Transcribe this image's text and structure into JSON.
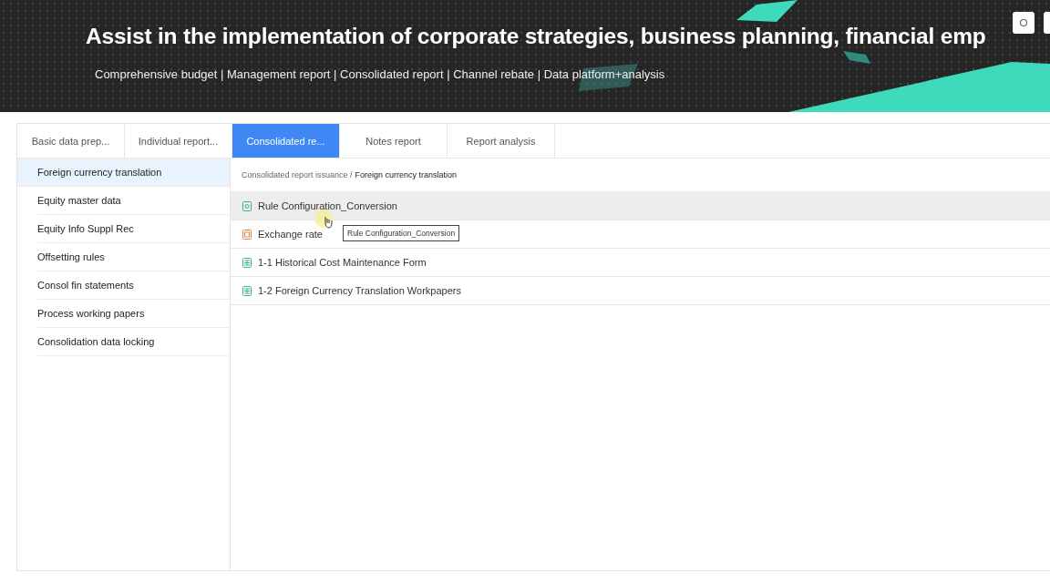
{
  "banner": {
    "title": "Assist in the implementation of corporate strategies, business planning, financial emp",
    "subtitle": "Comprehensive budget | Management report | Consolidated report | Channel rebate | Data platform+analysis"
  },
  "tabs": [
    {
      "label": "Basic data prep...",
      "selected": false
    },
    {
      "label": "Individual report...",
      "selected": false
    },
    {
      "label": "Consolidated re...",
      "selected": true
    },
    {
      "label": "Notes report",
      "selected": false
    },
    {
      "label": "Report analysis",
      "selected": false
    }
  ],
  "sidebar": {
    "items": [
      {
        "label": "Foreign currency translation",
        "selected": true
      },
      {
        "label": "Equity master data",
        "selected": false
      },
      {
        "label": "Equity Info Suppl Rec",
        "selected": false
      },
      {
        "label": "Offsetting rules",
        "selected": false
      },
      {
        "label": "Consol fin statements",
        "selected": false
      },
      {
        "label": "Process working papers",
        "selected": false
      },
      {
        "label": "Consolidation data locking",
        "selected": false
      }
    ]
  },
  "breadcrumb": {
    "parent": "Consolidated report issuance /",
    "current": "Foreign currency translation"
  },
  "files": [
    {
      "label": "Rule Configuration_Conversion",
      "kind": "document",
      "hovered": true
    },
    {
      "label": "Exchange rate",
      "kind": "calendar",
      "hovered": false
    },
    {
      "label": "1-1 Historical Cost Maintenance Form",
      "kind": "sheet",
      "hovered": false
    },
    {
      "label": "1-2 Foreign Currency Translation Workpapers",
      "kind": "sheet",
      "hovered": false
    }
  ],
  "tooltip": {
    "text": "Rule Configuration_Conversion"
  }
}
